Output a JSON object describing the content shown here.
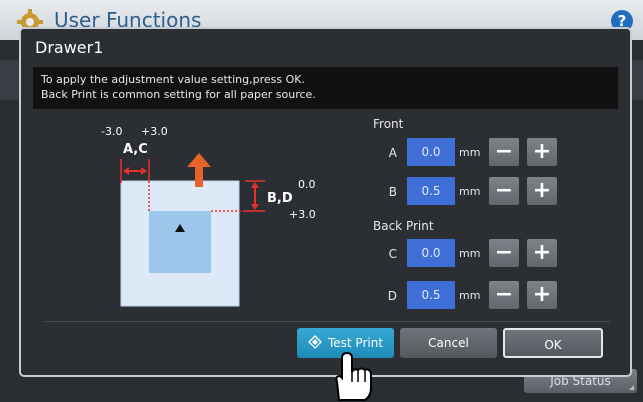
{
  "app": {
    "title": "User Functions",
    "help_label": "?",
    "job_status": "Job Status"
  },
  "dialog": {
    "title": "Drawer1",
    "info_lines": [
      "To apply the adjustment value setting,press OK.",
      "Back Print is common setting for all paper source."
    ]
  },
  "diagram": {
    "range_minus": "-3.0",
    "range_plus": "+3.0",
    "label_ac": "A,C",
    "label_bd": "B,D",
    "bd_top": "0.0",
    "bd_bottom": "+3.0"
  },
  "front": {
    "label": "Front",
    "rows": [
      {
        "label": "A",
        "value": "0.0",
        "unit": "mm"
      },
      {
        "label": "B",
        "value": "0.5",
        "unit": "mm"
      }
    ]
  },
  "back": {
    "label": "Back Print",
    "rows": [
      {
        "label": "C",
        "value": "0.0",
        "unit": "mm"
      },
      {
        "label": "D",
        "value": "0.5",
        "unit": "mm"
      }
    ]
  },
  "stepper": {
    "minus": "−",
    "plus": "+"
  },
  "buttons": {
    "test_print": "Test Print",
    "cancel": "Cancel",
    "ok": "OK"
  },
  "colors": {
    "field": "#3f6fd6",
    "test_print": "#2a9bc6",
    "arrow": "#e8632a",
    "paper": "#dde9f6",
    "inner": "#9cc7ea"
  }
}
